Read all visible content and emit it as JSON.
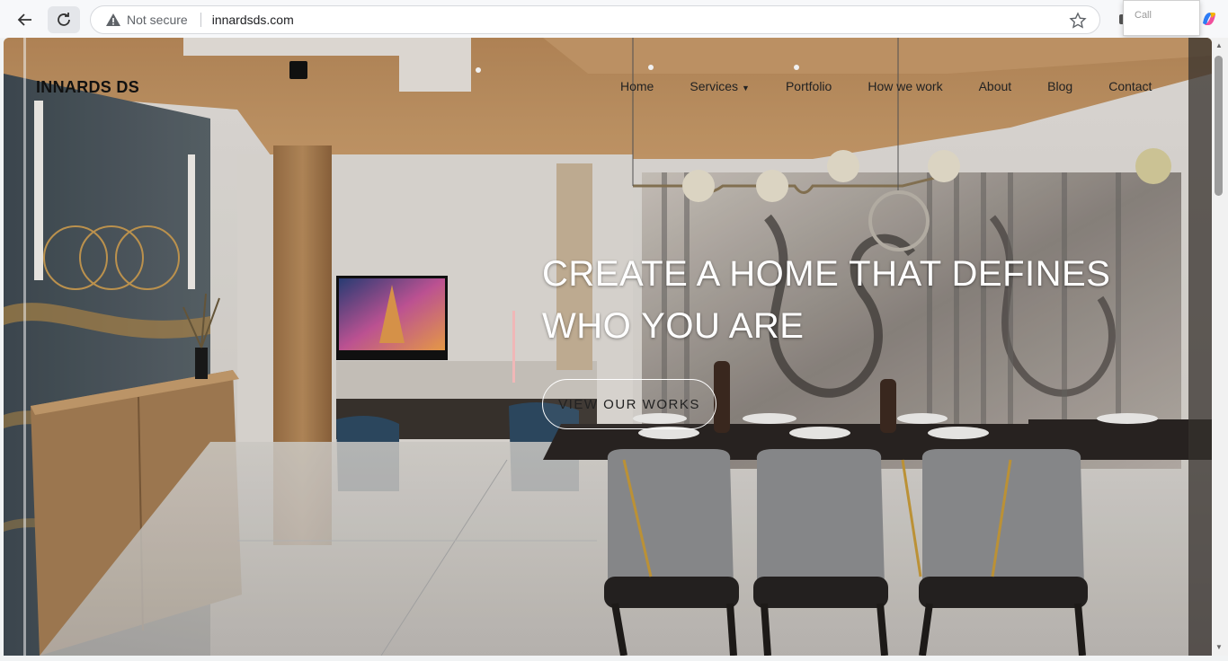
{
  "browser": {
    "security_label": "Not secure",
    "url": "innardsds.com",
    "popup_label": "Call"
  },
  "site": {
    "logo": "INNARDS DS",
    "nav": [
      {
        "label": "Home"
      },
      {
        "label": "Services",
        "has_dropdown": true
      },
      {
        "label": "Portfolio"
      },
      {
        "label": "How we work"
      },
      {
        "label": "About"
      },
      {
        "label": "Blog"
      },
      {
        "label": "Contact"
      }
    ]
  },
  "hero": {
    "title_line1": "CREATE A HOME THAT DEFINES",
    "title_line2": "WHO YOU ARE",
    "button_label": "VIEW OUR WORKS",
    "accent_color": "#f0b7b7"
  },
  "icons": [
    "back-arrow-icon",
    "reload-icon",
    "warning-icon",
    "star-icon",
    "extension-icon",
    "copilot-icon"
  ]
}
